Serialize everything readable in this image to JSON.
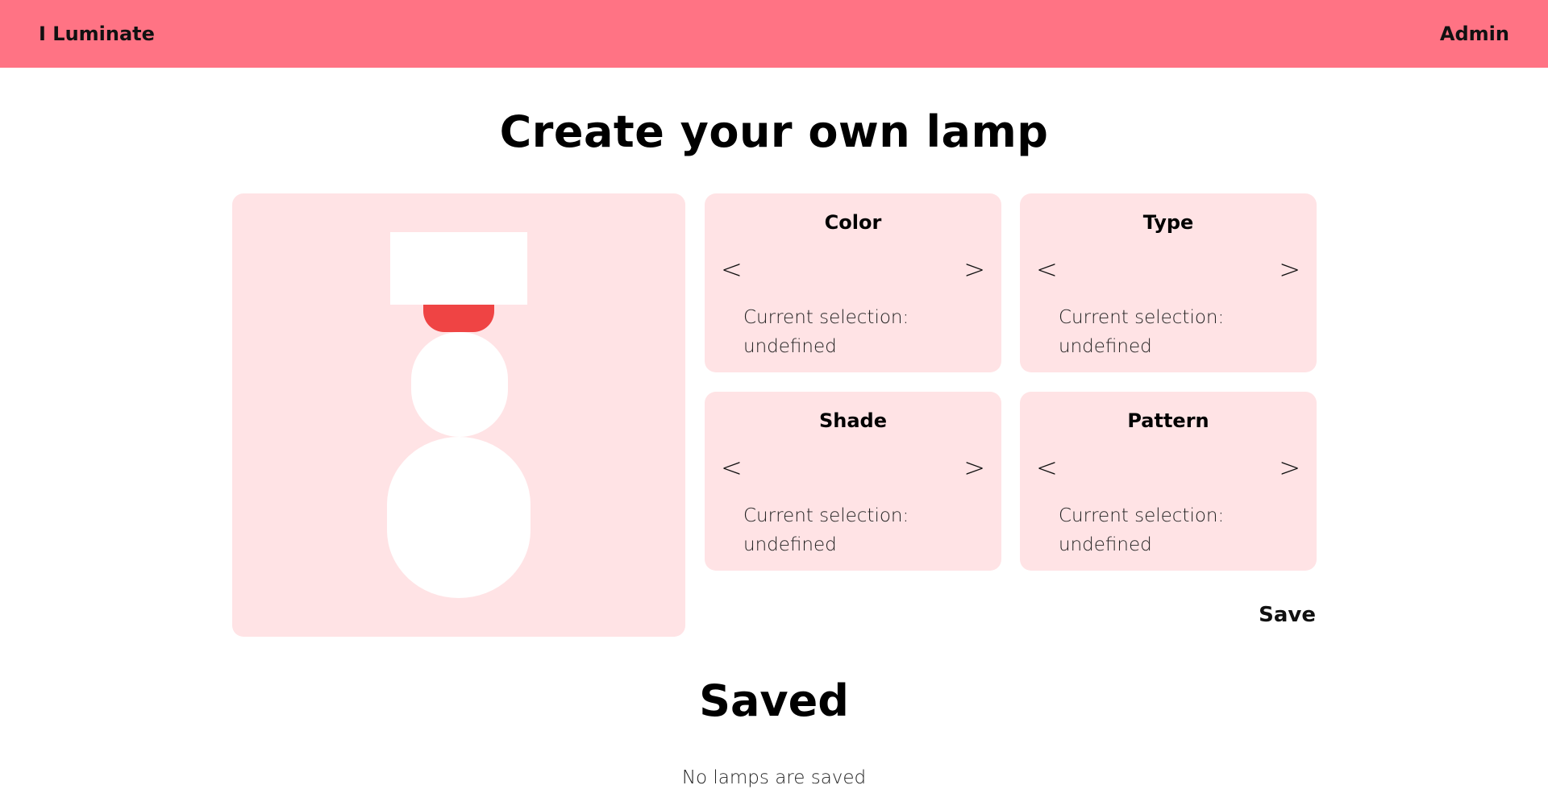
{
  "nav": {
    "brand": "I Luminate",
    "admin": "Admin"
  },
  "page_title": "Create your own lamp",
  "options": [
    {
      "title": "Color",
      "prev": "<",
      "next": ">",
      "selection_label": "Current selection:",
      "selection_value": "undefined"
    },
    {
      "title": "Type",
      "prev": "<",
      "next": ">",
      "selection_label": "Current selection:",
      "selection_value": "undefined"
    },
    {
      "title": "Shade",
      "prev": "<",
      "next": ">",
      "selection_label": "Current selection:",
      "selection_value": "undefined"
    },
    {
      "title": "Pattern",
      "prev": "<",
      "next": ">",
      "selection_label": "Current selection:",
      "selection_value": "undefined"
    }
  ],
  "save_label": "Save",
  "saved": {
    "title": "Saved",
    "empty_message": "No lamps are saved"
  },
  "colors": {
    "navbar": "#ff7384",
    "panel": "#ffe3e5",
    "bulb": "#ef4444"
  }
}
